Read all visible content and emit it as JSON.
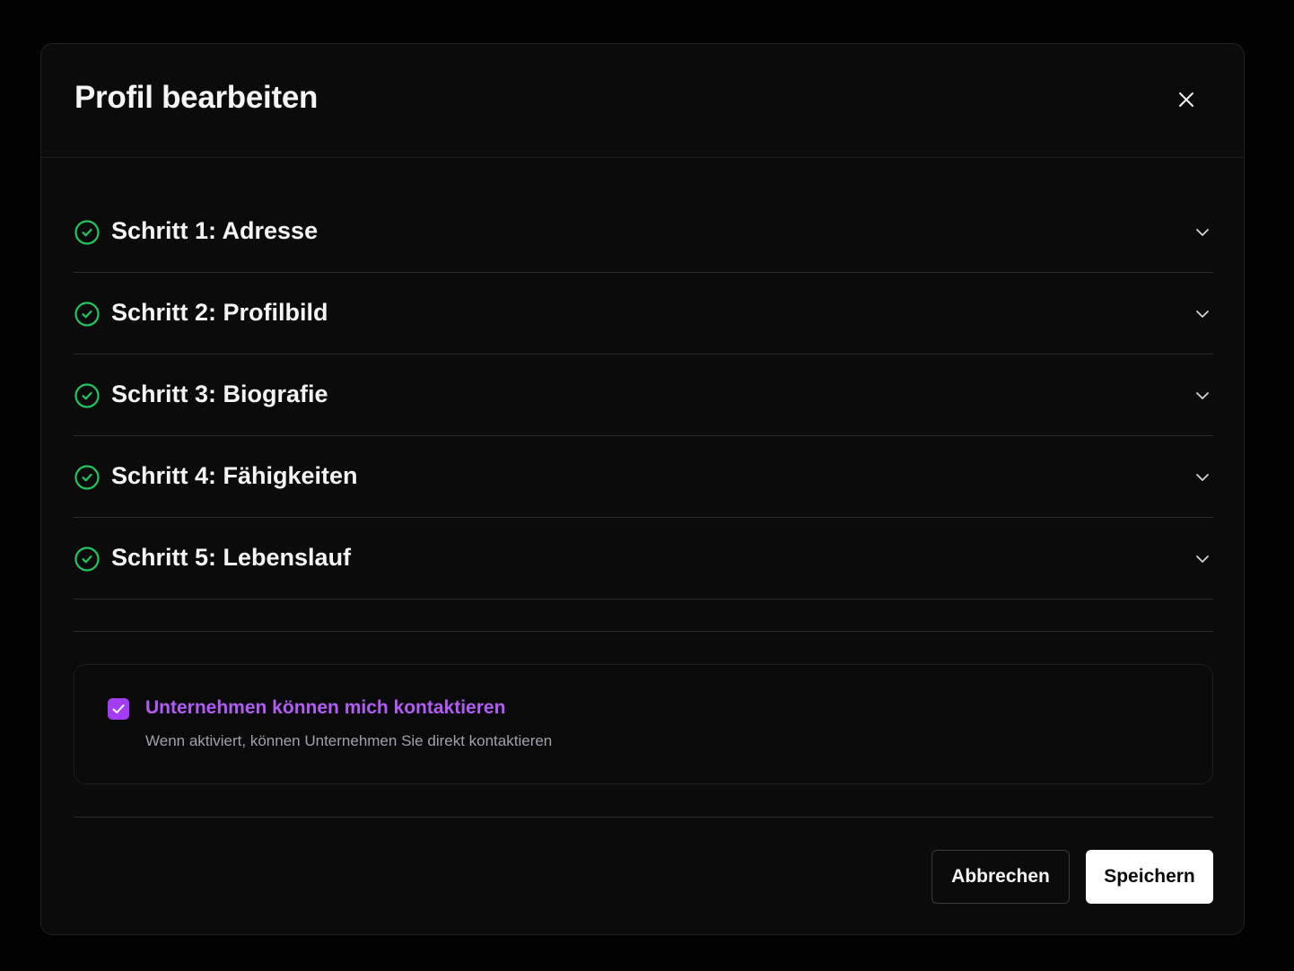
{
  "dialog": {
    "title": "Profil bearbeiten",
    "close_icon": "close-icon"
  },
  "steps": [
    {
      "label": "Schritt 1: Adresse",
      "status": "complete",
      "icon": "check-circle-icon"
    },
    {
      "label": "Schritt 2: Profilbild",
      "status": "complete",
      "icon": "check-circle-icon"
    },
    {
      "label": "Schritt 3: Biografie",
      "status": "complete",
      "icon": "check-circle-icon"
    },
    {
      "label": "Schritt 4: Fähigkeiten",
      "status": "complete",
      "icon": "check-circle-icon"
    },
    {
      "label": "Schritt 5: Lebenslauf",
      "status": "complete",
      "icon": "check-circle-icon"
    }
  ],
  "contact": {
    "checked": true,
    "label": "Unternehmen können mich kontaktieren",
    "description": "Wenn aktiviert, können Unternehmen Sie direkt kontaktieren"
  },
  "footer": {
    "cancel_label": "Abbrechen",
    "save_label": "Speichern"
  },
  "colors": {
    "accent": "#a23df5",
    "accent_text": "#b15cf5",
    "success": "#22c55e",
    "background": "#0b0b0c"
  }
}
